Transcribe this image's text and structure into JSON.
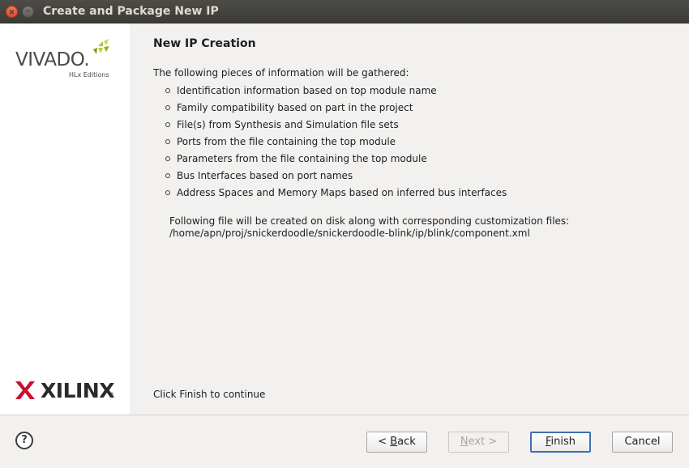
{
  "window": {
    "title": "Create and Package New IP",
    "close_glyph": "×",
    "minimize_glyph": "–"
  },
  "sidebar": {
    "vivado_logo_text": "VIVADO.",
    "vivado_logo_subtext": "HLx Editions",
    "xilinx_logo_text": "XILINX",
    "xilinx_logo_reg": "®"
  },
  "main": {
    "title": "New IP Creation",
    "intro": "The following pieces of information will be gathered:",
    "bullets": [
      "Identification information based on top module name",
      "Family compatibility based on part in the project",
      "File(s) from Synthesis and Simulation file sets",
      "Ports from the file containing the top module",
      "Parameters from the file containing the top module",
      "Bus Interfaces based on port names",
      "Address Spaces and Memory Maps based on inferred bus interfaces"
    ],
    "note_line1": "Following file will be created on disk along with corresponding customization files:",
    "note_line2": "/home/apn/proj/snickerdoodle/snickerdoodle-blink/ip/blink/component.xml",
    "footer": "Click Finish to continue"
  },
  "buttons": {
    "help": "?",
    "back_prefix": "< ",
    "back_mnemonic": "B",
    "back_rest": "ack",
    "next_mnemonic": "N",
    "next_rest": "ext >",
    "finish_mnemonic": "F",
    "finish_rest": "inish",
    "cancel": "Cancel"
  },
  "colors": {
    "titlebar": "#3c3b37",
    "close_button": "#e9573a",
    "content_bg": "#f2f1f0",
    "finish_border": "#3e6fb3",
    "xilinx_red": "#c8102e",
    "vivado_green": "#a3c43a"
  },
  "icons": {
    "close": "close-icon",
    "minimize": "minimize-icon",
    "help": "help-icon"
  }
}
